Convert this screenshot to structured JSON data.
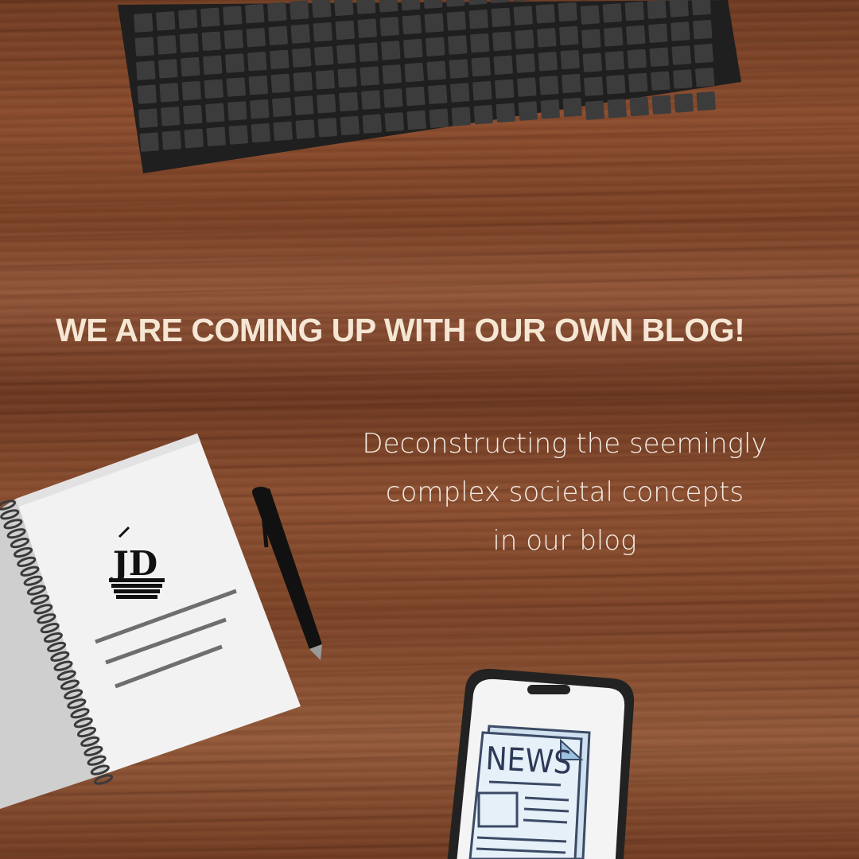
{
  "headline": "WE ARE COMING UP WITH OUR OWN BLOG!",
  "subtitle_lines": [
    "Deconstructing the seemingly",
    "complex societal concepts",
    "in our blog"
  ],
  "notebook_logo_text": "JD",
  "phone_screen_text": "NEWS",
  "colors": {
    "wood": "#7f4629",
    "headline": "#f6e6d4",
    "keyboard": "#1f1f1f",
    "keycap": "#3c3c3c",
    "notebook_page": "#f1f1f1",
    "news_paper": "#d7e6f1"
  }
}
